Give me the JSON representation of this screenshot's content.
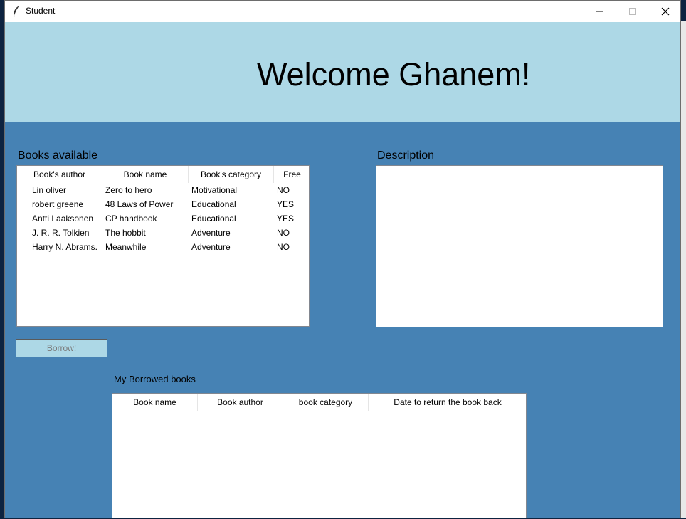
{
  "window": {
    "title": "Student"
  },
  "title_buttons": {
    "minimize": "—",
    "maximize": "☐",
    "close": "✕"
  },
  "header": {
    "welcome": "Welcome Ghanem!"
  },
  "books_available": {
    "label": "Books available",
    "columns": [
      "Book's author",
      "Book name",
      "Book's category",
      "Free"
    ],
    "rows": [
      [
        "Lin oliver",
        "Zero to hero",
        "Motivational",
        "NO"
      ],
      [
        "robert greene",
        "48 Laws of Power",
        "Educational",
        "YES"
      ],
      [
        "Antti Laaksonen",
        "CP handbook",
        "Educational",
        "YES"
      ],
      [
        "J. R. R. Tolkien",
        "The hobbit",
        "Adventure",
        "NO"
      ],
      [
        "Harry N. Abrams.",
        "Meanwhile",
        "Adventure",
        "NO"
      ]
    ]
  },
  "description": {
    "label": "Description"
  },
  "borrow_button": "Borrow!",
  "borrowed": {
    "label": "My Borrowed books",
    "columns": [
      "Book name",
      "Book author",
      "book category",
      "Date to return the book back"
    ]
  }
}
